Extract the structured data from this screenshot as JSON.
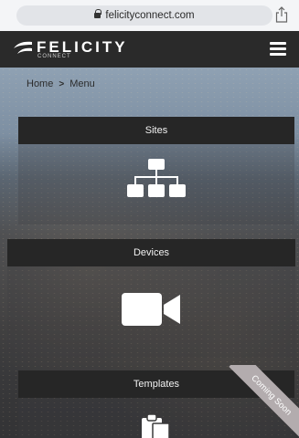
{
  "browser": {
    "url": "felicityconnect.com",
    "lock_icon": "lock-icon",
    "share_icon": "share-icon"
  },
  "header": {
    "logo_name": "FELICITY",
    "logo_sub": "CONNECT",
    "menu_icon": "hamburger-menu-icon"
  },
  "breadcrumb": {
    "home": "Home",
    "separator": ">",
    "current": "Menu"
  },
  "cards": [
    {
      "title": "Sites",
      "icon": "sitemap-icon"
    },
    {
      "title": "Devices",
      "icon": "video-camera-icon"
    },
    {
      "title": "Templates",
      "icon": "clipboard-icon",
      "badge": "Coming Soon"
    }
  ],
  "colors": {
    "header_bg": "#2a2a2a",
    "card_header_bg": "#262626",
    "ribbon_bg": "#b3acae"
  }
}
